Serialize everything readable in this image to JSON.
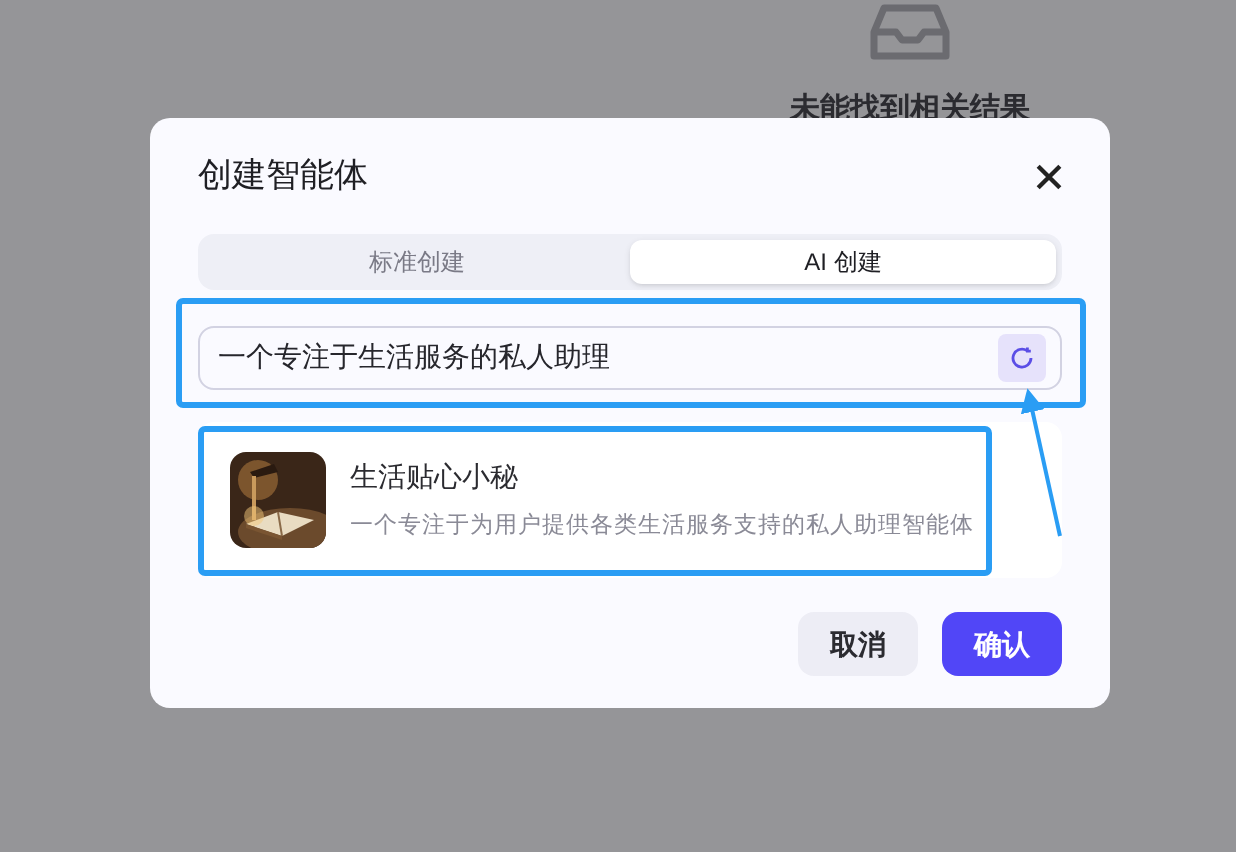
{
  "background": {
    "empty_message": "未能找到相关结果"
  },
  "dialog": {
    "title": "创建智能体",
    "tabs": [
      {
        "label": "标准创建",
        "selected": false
      },
      {
        "label": "AI 创建",
        "selected": true
      }
    ],
    "prompt_field": {
      "value": "一个专注于生活服务的私人助理"
    },
    "result": {
      "name": "生活贴心小秘",
      "description": "一个专注于为用户提供各类生活服务支持的私人助理智能体"
    },
    "buttons": [
      {
        "label": "取消",
        "kind": "secondary"
      },
      {
        "label": "确认",
        "kind": "primary"
      }
    ]
  }
}
